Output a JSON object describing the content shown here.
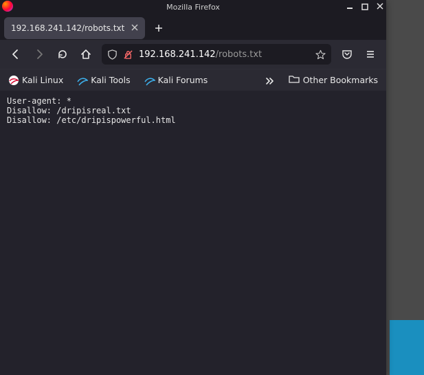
{
  "window": {
    "title": "Mozilla Firefox"
  },
  "tabs": [
    {
      "title": "192.168.241.142/robots.txt"
    }
  ],
  "url": {
    "host": "192.168.241.142",
    "path": "/robots.txt"
  },
  "bookmarks": {
    "items": [
      {
        "label": "Kali Linux"
      },
      {
        "label": "Kali Tools"
      },
      {
        "label": "Kali Forums"
      }
    ],
    "other_label": "Other Bookmarks"
  },
  "page_body": "User-agent: *\nDisallow: /dripisreal.txt\nDisallow: /etc/dripispowerful.html"
}
